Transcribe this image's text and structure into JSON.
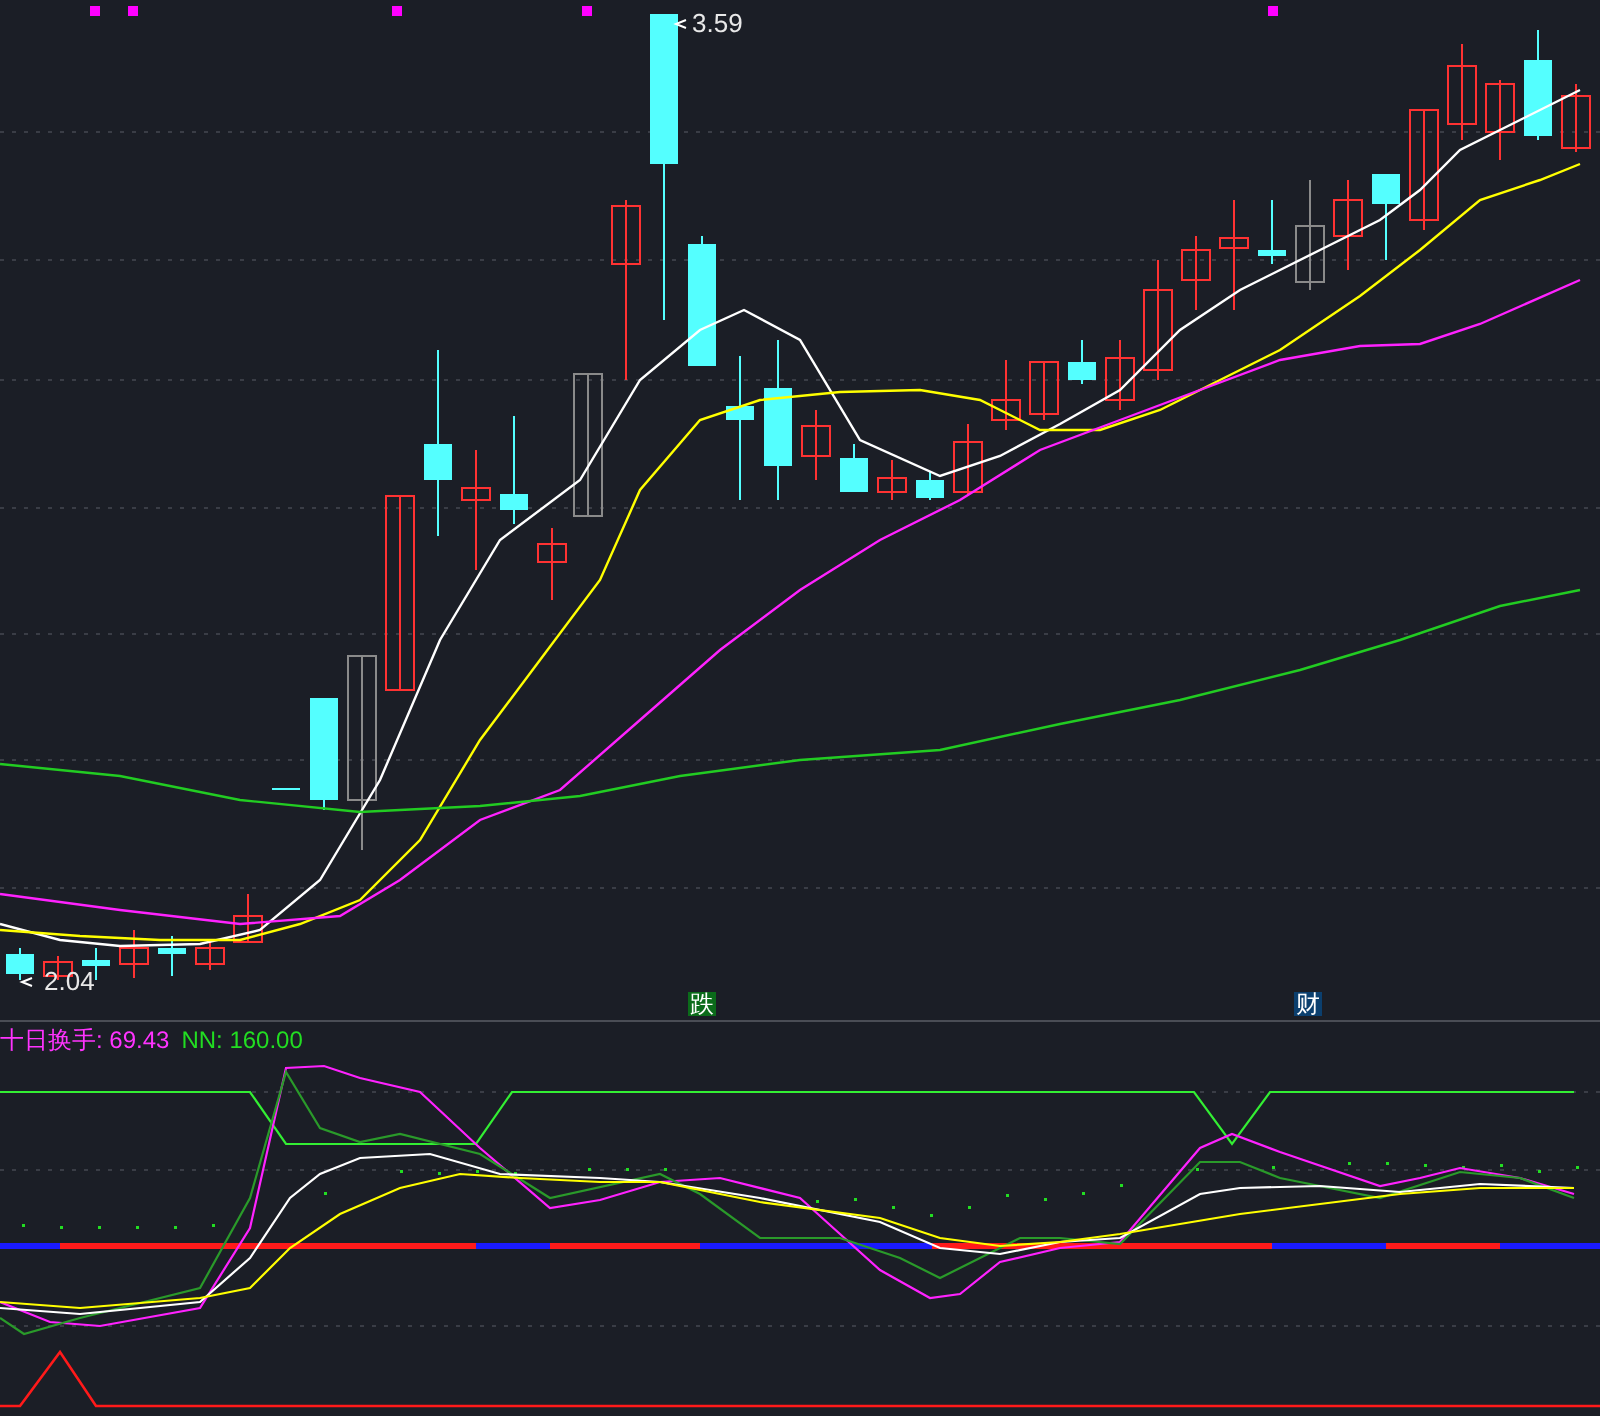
{
  "price_chart": {
    "high_label": "3.59",
    "low_label": "2.04",
    "signals": [
      {
        "text": "跌",
        "color": "#0b6b1a"
      },
      {
        "text": "财",
        "color": "#0b3f6e"
      }
    ]
  },
  "indicator": {
    "legend": [
      {
        "text": "十日换手: 69.43",
        "color": "#ff33ff"
      },
      {
        "text": "NN: 160.00",
        "color": "#22dd22"
      }
    ]
  }
}
